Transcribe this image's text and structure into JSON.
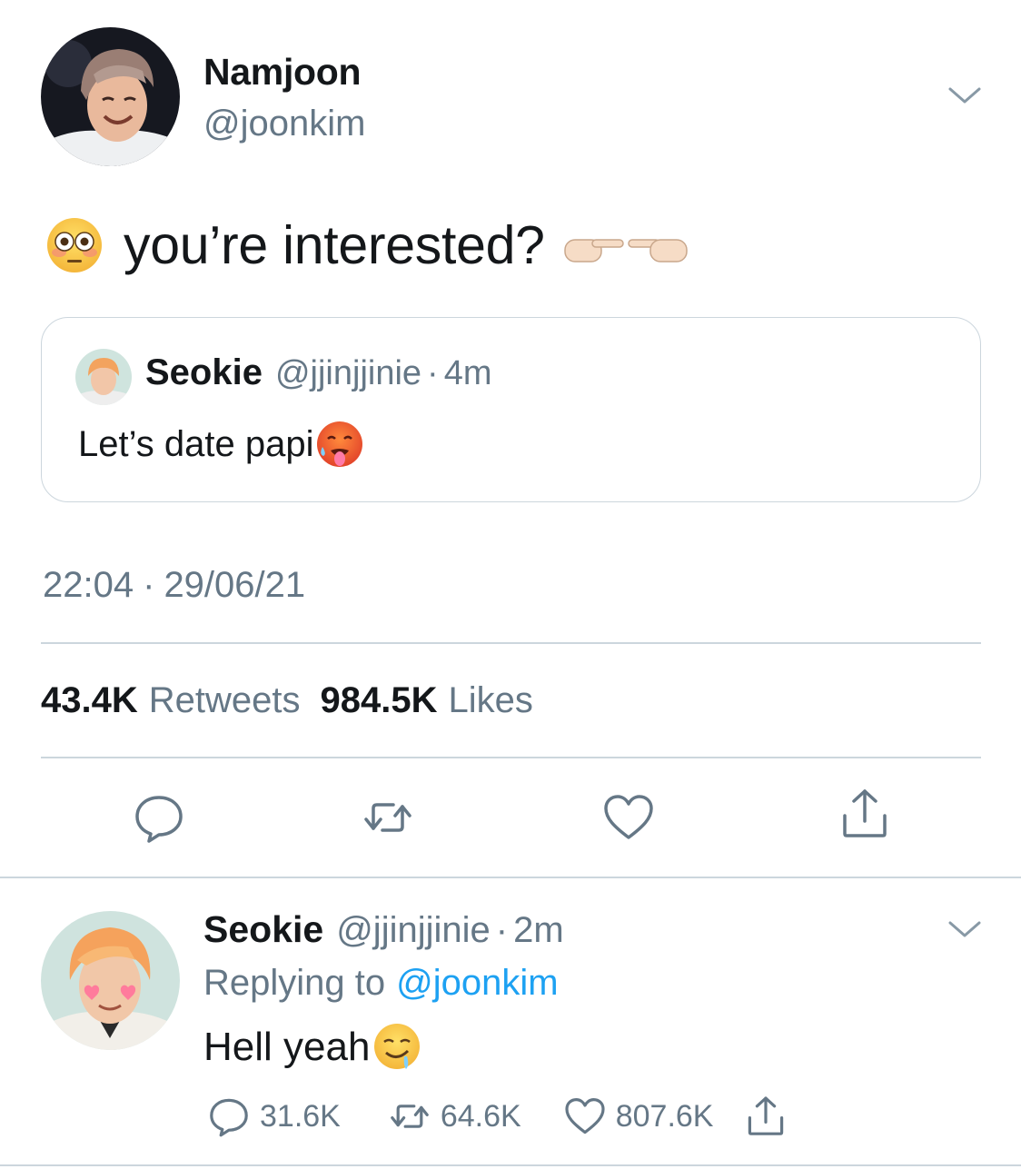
{
  "main_tweet": {
    "name": "Namjoon",
    "handle": "@joonkim",
    "text": "you’re interested?",
    "leading_emoji": "flushed-face-emoji",
    "trailing_emoji": "pointing-fingers-emoji",
    "quoted": {
      "name": "Seokie",
      "handle": "@jjinjjinie",
      "dot": "·",
      "time": "4m",
      "text": "Let’s date papi",
      "emoji": "hot-face-emoji"
    },
    "timestamp": {
      "time": "22:04",
      "dot": "·",
      "date": "29/06/21"
    },
    "stats": {
      "retweets_count": "43.4K",
      "retweets_label": "Retweets",
      "likes_count": "984.5K",
      "likes_label": "Likes"
    },
    "actions": [
      "reply-icon",
      "retweet-icon",
      "like-icon",
      "share-icon"
    ]
  },
  "reply_tweet": {
    "name": "Seokie",
    "handle": "@jjinjjinie",
    "dot": "·",
    "time": "2m",
    "replying_prefix": "Replying to",
    "replying_mention": "@joonkim",
    "text": "Hell yeah",
    "emoji": "drooling-face-emoji",
    "reply_count": "31.6K",
    "retweet_count": "64.6K",
    "like_count": "807.6K"
  },
  "colors": {
    "text_primary": "#14171a",
    "text_secondary": "#657786",
    "link": "#1da1f2",
    "divider": "#ccd6dd"
  }
}
